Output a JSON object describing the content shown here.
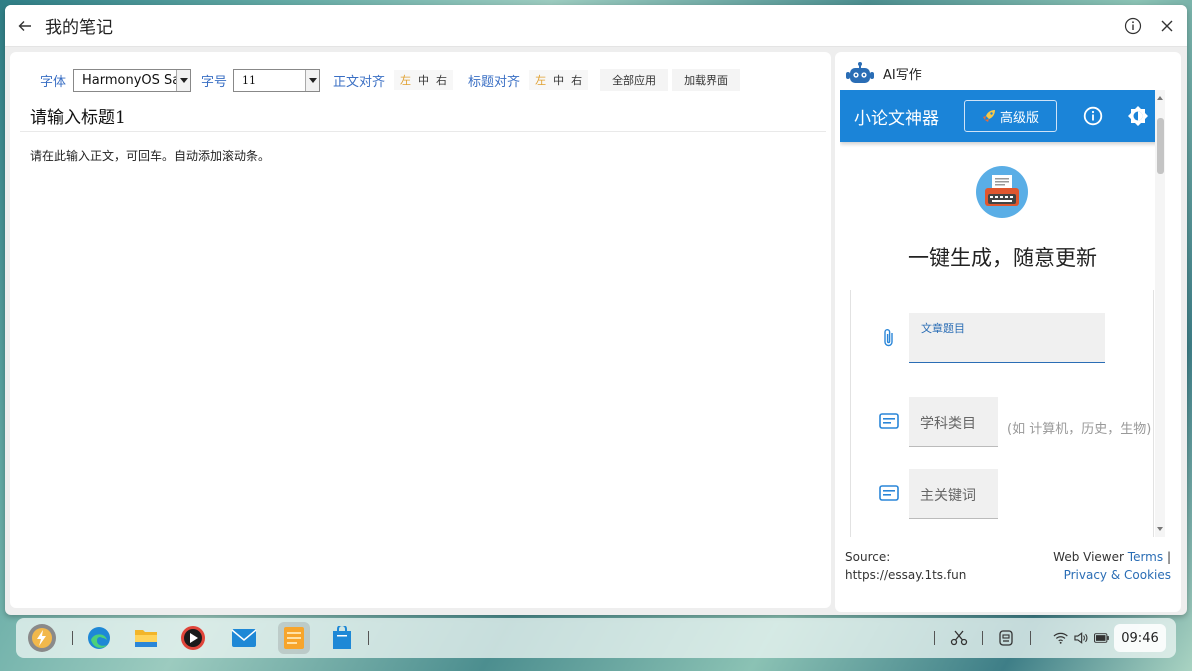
{
  "window": {
    "title": "我的笔记"
  },
  "toolbar": {
    "font_label": "字体",
    "font_value": "HarmonyOS Sa",
    "size_label": "字号",
    "size_value": "11",
    "body_align_label": "正文对齐",
    "title_align_label": "标题对齐",
    "align_left": "左",
    "align_center": "中",
    "align_right": "右",
    "apply_all": "全部应用",
    "load_ui": "加载界面"
  },
  "editor": {
    "title_placeholder": "请输入标题1",
    "body_placeholder": "请在此输入正文，可回车。自动添加滚动条。"
  },
  "ai_panel": {
    "header": "AI写作",
    "app_name": "小论文神器",
    "pro_button": "高级版",
    "slogan": "一键生成，随意更新",
    "field_title_label": "文章题目",
    "field_subject": "学科类目",
    "field_subject_hint": "(如 计算机，历史，生物)",
    "field_keyword": "主关键词",
    "footer_source_label": "Source:",
    "footer_source_url": "https://essay.1ts.fun",
    "footer_viewer": "Web Viewer",
    "footer_terms": "Terms",
    "footer_sep": "|",
    "footer_privacy": "Privacy & Cookies"
  },
  "taskbar": {
    "clock": "09:46",
    "apps": [
      "start-icon",
      "edge-icon",
      "file-explorer-icon",
      "media-player-icon",
      "mail-icon",
      "notes-app-icon",
      "store-icon"
    ]
  },
  "colors": {
    "accent_blue": "#1b84d8",
    "label_blue": "#3a6fc4",
    "align_active": "#e0a030"
  }
}
